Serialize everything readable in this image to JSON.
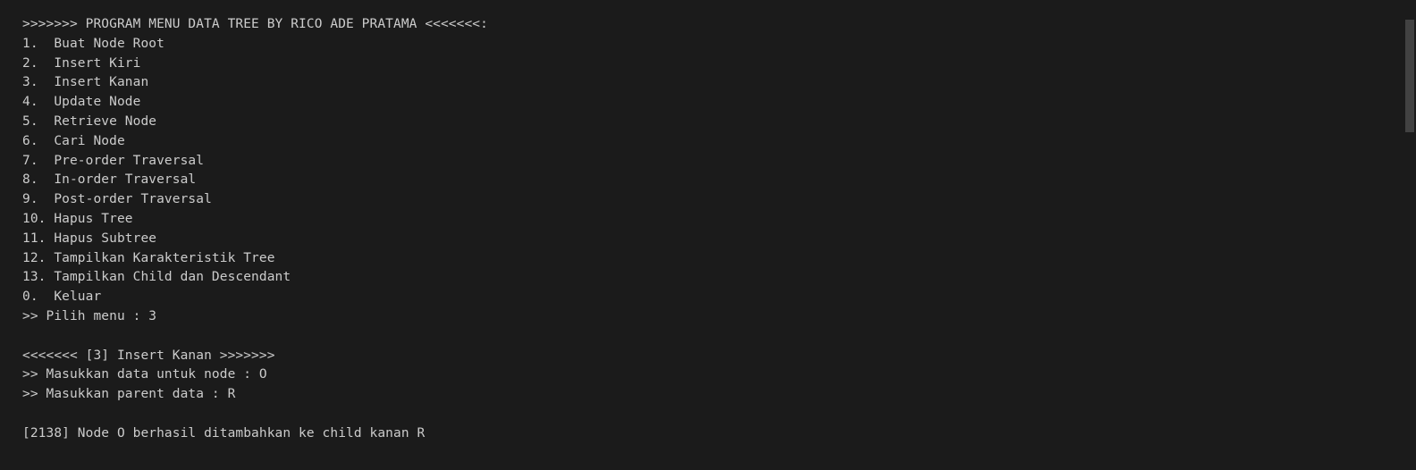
{
  "terminal": {
    "header": ">>>>>>> PROGRAM MENU DATA TREE BY RICO ADE PRATAMA <<<<<<<:",
    "menu": [
      "1.  Buat Node Root",
      "2.  Insert Kiri",
      "3.  Insert Kanan",
      "4.  Update Node",
      "5.  Retrieve Node",
      "6.  Cari Node",
      "7.  Pre-order Traversal",
      "8.  In-order Traversal",
      "9.  Post-order Traversal",
      "10. Hapus Tree",
      "11. Hapus Subtree",
      "12. Tampilkan Karakteristik Tree",
      "13. Tampilkan Child dan Descendant",
      "0.  Keluar"
    ],
    "prompt_menu": ">> Pilih menu : 3",
    "section_header": "<<<<<<< [3] Insert Kanan >>>>>>>",
    "prompt_node": ">> Masukkan data untuk node : O",
    "prompt_parent": ">> Masukkan parent data : R",
    "result": "[2138] Node O berhasil ditambahkan ke child kanan R"
  }
}
